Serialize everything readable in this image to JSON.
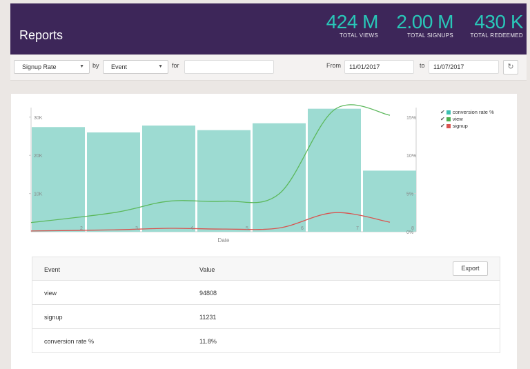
{
  "header": {
    "title": "Reports",
    "stats": [
      {
        "value": "424 M",
        "label": "TOTAL VIEWS"
      },
      {
        "value": "2.00 M",
        "label": "TOTAL SIGNUPS"
      },
      {
        "value": "430 K",
        "label": "TOTAL REDEEMED"
      }
    ]
  },
  "filters": {
    "metric": "Signup Rate",
    "by_label": "by",
    "group": "Event",
    "for_label": "for",
    "for_value": "",
    "from_label": "From",
    "from_date": "11/01/2017",
    "to_label": "to",
    "to_date": "11/07/2017"
  },
  "chart_data": {
    "type": "bar",
    "xlabel": "Date",
    "x_ticks": [
      "2",
      "3",
      "4",
      "5",
      "6",
      "7",
      "8"
    ],
    "y_left_ticks": [
      "30K",
      "20K",
      "10K"
    ],
    "y_right_ticks": [
      "15%",
      "10%",
      "5%",
      "0%"
    ],
    "y_left_range": [
      0,
      32500
    ],
    "y_right_range": [
      0,
      16.25
    ],
    "legend": [
      "conversion rate %",
      "view",
      "signup"
    ],
    "colors": {
      "conversion": "#9ddbd2",
      "view": "#5cb85c",
      "signup": "#d9534f"
    },
    "series": [
      {
        "name": "conversion rate %",
        "axis": "right",
        "type": "bar",
        "values": [
          13.7,
          13.0,
          13.9,
          13.3,
          14.2,
          16.1,
          8.0
        ]
      },
      {
        "name": "view",
        "axis": "left",
        "type": "line",
        "x": [
          1.5,
          2.5,
          3.5,
          4.5,
          5.5,
          6.5,
          7.5
        ],
        "values": [
          2400,
          5000,
          8000,
          8000,
          10000,
          32000,
          30500
        ]
      },
      {
        "name": "signup",
        "axis": "left",
        "type": "line",
        "x": [
          1.5,
          2.5,
          3.5,
          4.5,
          5.5,
          6.5,
          7.5
        ],
        "values": [
          200,
          500,
          900,
          700,
          1000,
          5000,
          2500
        ]
      }
    ]
  },
  "table": {
    "headers": [
      "Event",
      "Value"
    ],
    "export_label": "Export",
    "rows": [
      {
        "event": "view",
        "value": "94808"
      },
      {
        "event": "signup",
        "value": "11231"
      },
      {
        "event": "conversion rate %",
        "value": "11.8%"
      }
    ]
  }
}
